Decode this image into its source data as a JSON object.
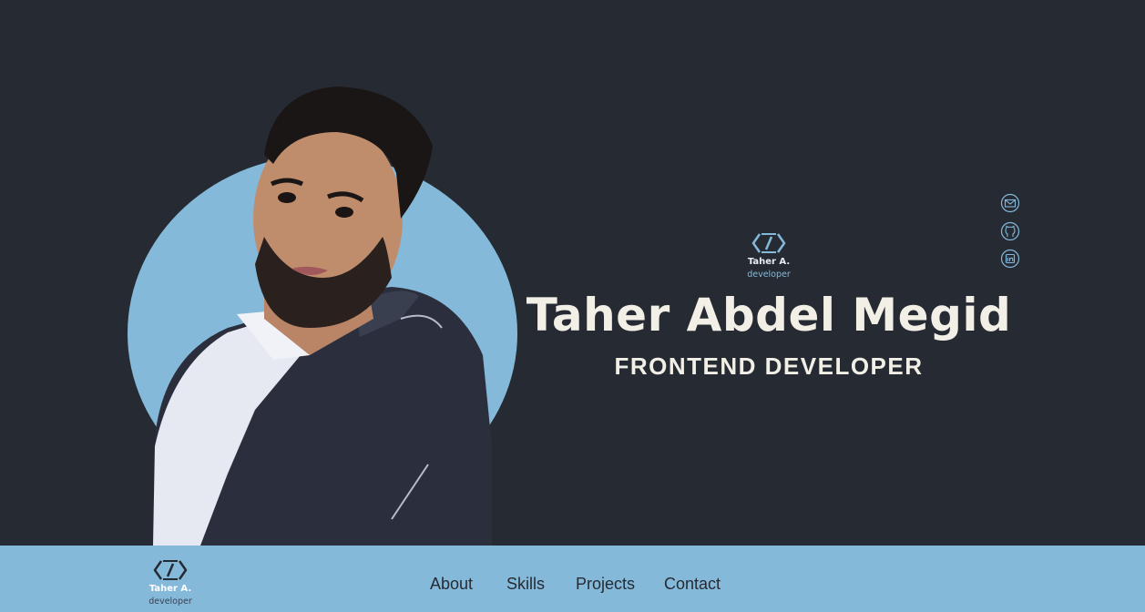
{
  "colors": {
    "background": "#262b33",
    "accent": "#84b9da",
    "hero_text": "#f2efe6"
  },
  "hero": {
    "logo": {
      "icon": "code-brackets-icon",
      "name": "Taher A.",
      "subtitle": "developer"
    },
    "name": "Taher Abdel Megid",
    "role": "FRONTEND DEVELOPER",
    "portrait": {
      "icon": "portrait-photo"
    }
  },
  "social": [
    {
      "icon": "mail-icon"
    },
    {
      "icon": "github-icon"
    },
    {
      "icon": "linkedin-icon"
    }
  ],
  "footer": {
    "logo": {
      "icon": "code-brackets-icon",
      "name": "Taher A.",
      "subtitle": "developer"
    },
    "nav": [
      {
        "label": "About"
      },
      {
        "label": "Skills"
      },
      {
        "label": "Projects"
      },
      {
        "label": "Contact"
      }
    ]
  }
}
